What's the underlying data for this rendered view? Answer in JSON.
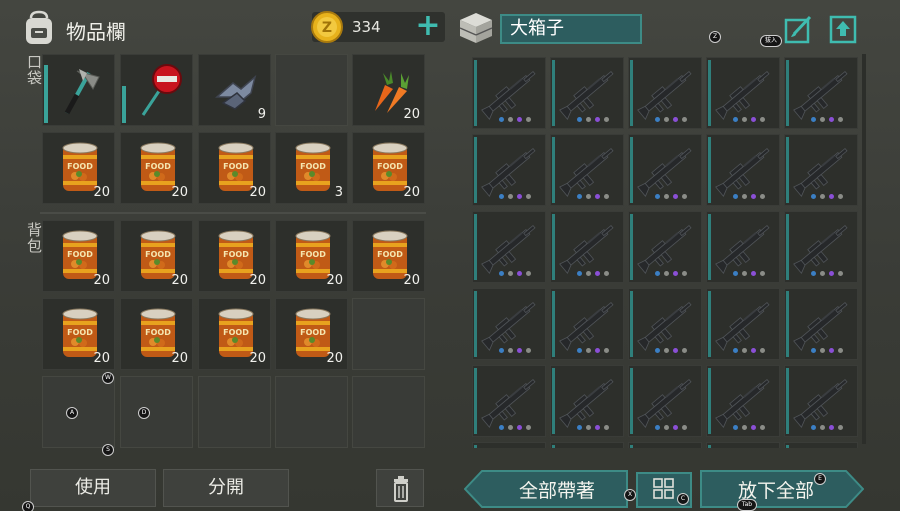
{
  "inventory": {
    "title": "物品欄",
    "coins": "334",
    "plus_label": "+",
    "pocket_label": "口袋",
    "backpack_label": "背包",
    "pocket_slots": [
      {
        "item": "hatchet-icon",
        "qty": "",
        "durability": 0.85
      },
      {
        "item": "stop-sign-icon",
        "qty": "",
        "durability": 0.55
      },
      {
        "item": "scrap-metal-icon",
        "qty": "9"
      },
      {
        "item": "",
        "qty": ""
      },
      {
        "item": "carrot-icon",
        "qty": "20"
      },
      {
        "item": "food-can-icon",
        "qty": "20"
      },
      {
        "item": "food-can-icon",
        "qty": "20"
      },
      {
        "item": "food-can-icon",
        "qty": "20"
      },
      {
        "item": "food-can-icon",
        "qty": "3"
      },
      {
        "item": "food-can-icon",
        "qty": "20"
      }
    ],
    "backpack_slots": [
      {
        "item": "food-can-icon",
        "qty": "20"
      },
      {
        "item": "food-can-icon",
        "qty": "20"
      },
      {
        "item": "food-can-icon",
        "qty": "20"
      },
      {
        "item": "food-can-icon",
        "qty": "20"
      },
      {
        "item": "food-can-icon",
        "qty": "20"
      },
      {
        "item": "food-can-icon",
        "qty": "20"
      },
      {
        "item": "food-can-icon",
        "qty": "20"
      },
      {
        "item": "food-can-icon",
        "qty": "20"
      },
      {
        "item": "food-can-icon",
        "qty": "20"
      },
      {
        "item": "",
        "qty": ""
      },
      {
        "item": "",
        "qty": ""
      },
      {
        "item": "",
        "qty": ""
      },
      {
        "item": "",
        "qty": ""
      },
      {
        "item": "",
        "qty": ""
      },
      {
        "item": "",
        "qty": ""
      }
    ],
    "use_label": "使用",
    "split_label": "分開",
    "can_text": "FOOD"
  },
  "storage": {
    "name": "大箱子",
    "pull_label": "拔入",
    "take_all_label": "全部帶著",
    "drop_all_label": "放下全部",
    "item": "assault-rifle-icon",
    "columns": 5,
    "visible_rows": 6,
    "dot_colors": [
      "#3b7fc4",
      "#8a8c87",
      "#8a4fd6",
      "#8a8c87"
    ]
  },
  "key_hints": {
    "z": "Z",
    "w": "W",
    "a": "A",
    "d": "D",
    "s": "S",
    "x": "X",
    "c": "C",
    "e": "E",
    "q": "Q",
    "tab": "Tab"
  },
  "colors": {
    "accent": "#3d8b86",
    "teal_fill": "#2d5d5f",
    "coin": "#e7b21c"
  }
}
